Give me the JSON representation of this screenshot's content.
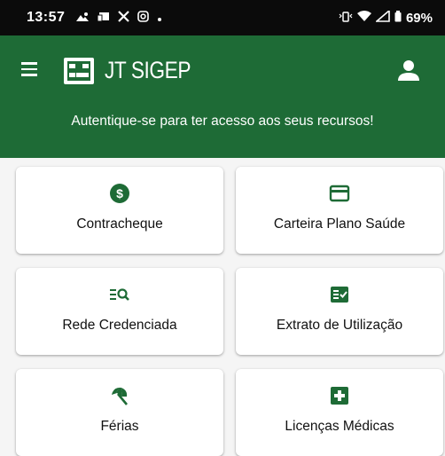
{
  "status_bar": {
    "time": "13:57",
    "battery": "69%",
    "left_icons": [
      "notification-icon",
      "cast-icon",
      "x-icon",
      "instagram-icon",
      "dot-icon"
    ],
    "right_icons": [
      "vibrate-icon",
      "wifi-icon",
      "signal-icon",
      "battery-icon"
    ]
  },
  "app_bar": {
    "title": "JT SIGEP",
    "banner": "Autentique-se para ter acesso aos seus recursos!",
    "color": "#1e6b36"
  },
  "menu_items": [
    {
      "label": "Contracheque",
      "icon": "dollar-coin-icon"
    },
    {
      "label": "Carteira Plano Saúde",
      "icon": "card-icon"
    },
    {
      "label": "Rede Credenciada",
      "icon": "list-search-icon"
    },
    {
      "label": "Extrato de Utilização",
      "icon": "fact-check-icon"
    },
    {
      "label": "Férias",
      "icon": "beach-umbrella-icon"
    },
    {
      "label": "Licenças Médicas",
      "icon": "medical-cross-icon"
    }
  ]
}
